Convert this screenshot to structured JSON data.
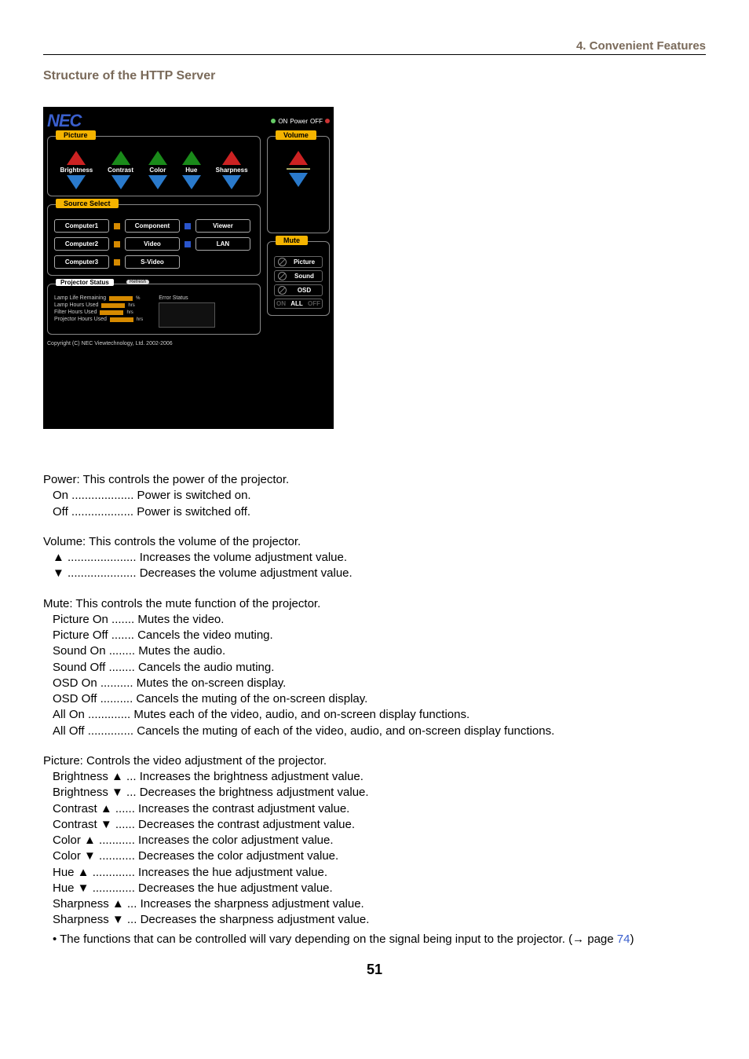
{
  "header": {
    "section": "4. Convenient Features"
  },
  "title": "Structure of the HTTP Server",
  "ui": {
    "logo": "NEC",
    "power": {
      "on": "ON",
      "label": "Power",
      "off": "OFF"
    },
    "picture_panel": {
      "title": "Picture",
      "controls": [
        "Brightness",
        "Contrast",
        "Color",
        "Hue",
        "Sharpness"
      ]
    },
    "volume_panel": {
      "title": "Volume"
    },
    "source_panel": {
      "title": "Source Select",
      "row1": [
        "Computer1",
        "Component",
        "Viewer"
      ],
      "row2": [
        "Computer2",
        "Video",
        "LAN"
      ],
      "row3": [
        "Computer3",
        "S-Video"
      ]
    },
    "mute_panel": {
      "title": "Mute",
      "rows": [
        "Picture",
        "Sound",
        "OSD"
      ],
      "all_on": "ON",
      "all_mid": "ALL",
      "all_off": "OFF"
    },
    "status_panel": {
      "title": "Projector Status",
      "refresh": "Refresh",
      "rows": [
        {
          "label": "Lamp Life Remaining",
          "unit": "%"
        },
        {
          "label": "Lamp Hours Used",
          "unit": "hrs"
        },
        {
          "label": "Filter Hours Used",
          "unit": "hrs"
        },
        {
          "label": "Projector Hours Used",
          "unit": "hrs"
        }
      ],
      "error": "Error Status"
    },
    "copyright": "Copyright (C) NEC Viewtechnology, Ltd. 2002-2006"
  },
  "text": {
    "power": {
      "heading": "Power: This controls the power of the projector.",
      "on": "On ................... Power is switched on.",
      "off": "Off ................... Power is switched off."
    },
    "volume": {
      "heading": "Volume: This controls the volume of the projector.",
      "up": "▲ ..................... Increases the volume adjustment value.",
      "down": "▼ ..................... Decreases the volume adjustment value."
    },
    "mute": {
      "heading": "Mute: This controls the mute function of the projector.",
      "lines": [
        "Picture On ....... Mutes the video.",
        "Picture Off ....... Cancels the video muting.",
        "Sound On ........ Mutes the audio.",
        "Sound Off ........ Cancels the audio muting.",
        "OSD On .......... Mutes the on-screen display.",
        "OSD Off .......... Cancels the muting of the on-screen display.",
        "All On ............. Mutes each of the video, audio, and on-screen display functions.",
        "All Off .............. Cancels the muting of each of the video, audio, and on-screen display functions."
      ]
    },
    "picture": {
      "heading": "Picture: Controls the video adjustment of the projector.",
      "lines": [
        "Brightness ▲ ... Increases the brightness adjustment value.",
        "Brightness ▼ ... Decreases the brightness adjustment value.",
        "Contrast ▲ ...... Increases the contrast adjustment value.",
        "Contrast ▼ ...... Decreases the contrast adjustment value.",
        "Color ▲ ........... Increases the color adjustment value.",
        "Color ▼ ........... Decreases the color adjustment value.",
        "Hue ▲ ............. Increases the hue adjustment value.",
        "Hue ▼ ............. Decreases the hue adjustment value.",
        "Sharpness ▲ ... Increases the sharpness adjustment value.",
        "Sharpness ▼ ... Decreases the sharpness adjustment value."
      ]
    },
    "note_prefix": "•   The functions that can be controlled will vary depending on the signal being input to the projector. (→ page ",
    "note_page": "74",
    "note_suffix": ")"
  },
  "page_number": "51"
}
